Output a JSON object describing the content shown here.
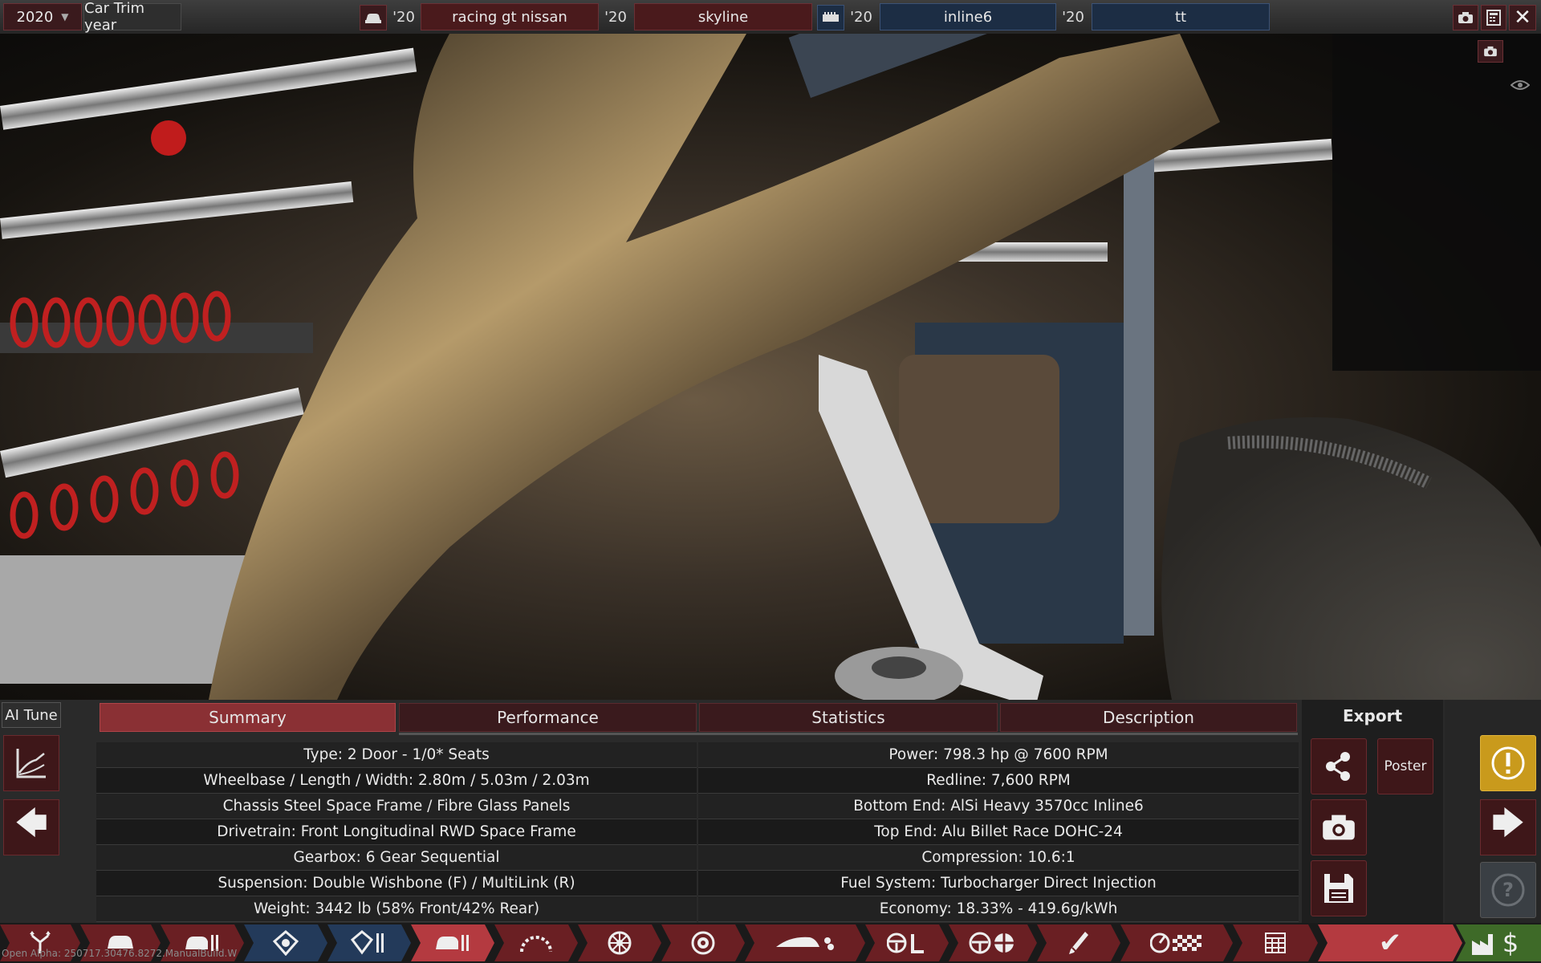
{
  "topbar": {
    "year": "2020",
    "year_label": "Car Trim year",
    "fields": [
      {
        "year": "'20",
        "value": "racing gt nissan"
      },
      {
        "year": "'20",
        "value": "skyline"
      },
      {
        "year": "'20",
        "value": "inline6"
      },
      {
        "year": "'20",
        "value": "tt"
      }
    ]
  },
  "viewport": {
    "camera_icon": "camera-icon",
    "eye_icon": "eye-icon"
  },
  "panel": {
    "ai_tune": "AI Tune",
    "tabs": [
      "Summary",
      "Performance",
      "Statistics",
      "Description"
    ],
    "active_tab": "Summary",
    "export_label": "Export",
    "poster_label": "Poster",
    "left_rows": [
      "Type: 2 Door - 1/0* Seats",
      "Wheelbase / Length / Width: 2.80m / 5.03m / 2.03m",
      "Chassis Steel Space Frame / Fibre Glass Panels",
      "Drivetrain: Front Longitudinal RWD Space Frame",
      "Gearbox: 6 Gear Sequential",
      "Suspension: Double Wishbone (F) / MultiLink (R)",
      "Weight: 3442 lb (58% Front/42% Rear)"
    ],
    "right_rows": [
      "Power: 798.3 hp @ 7600 RPM",
      "Redline:  7,600 RPM",
      "Bottom End: AlSi Heavy 3570cc Inline6",
      "Top End: Alu Billet Race DOHC-24",
      "Compression: 10.6:1",
      "Fuel System: Turbocharger Direct Injection",
      "Economy: 18.33% - 419.6g/kWh"
    ]
  },
  "toolbar": {
    "items": [
      "tree-icon",
      "car-body-icon",
      "car-trim-icon",
      "engine-family-icon",
      "engine-variant-icon",
      "car-design-icon",
      "gauge-icon",
      "wheel-icon",
      "brake-icon",
      "aero-icon",
      "interior-icon",
      "handling-icon",
      "fixtures-icon",
      "performance-icon",
      "test-track-icon",
      "spreadsheet-icon",
      "confirm-icon",
      "factory-cost-icon"
    ]
  },
  "footer": "Open Alpha: 250717.30476.8272.ManualBuild.W",
  "colors": {
    "accent_red": "#8a3034",
    "accent_blue": "#1c2d44",
    "warning_yellow": "#c99a1c"
  }
}
